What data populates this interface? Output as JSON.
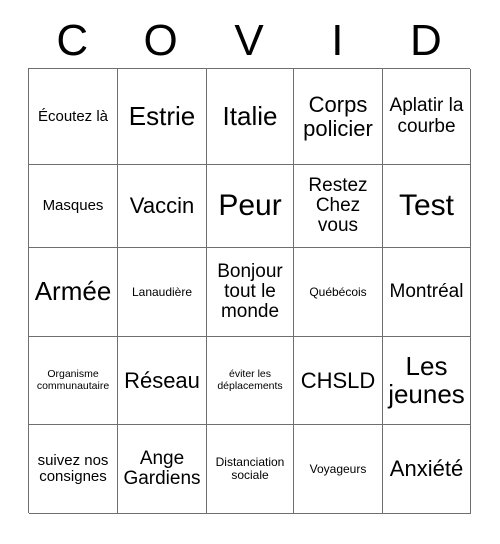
{
  "card": {
    "header_letters": [
      "C",
      "O",
      "V",
      "I",
      "D"
    ],
    "columns": 5,
    "rows": 5,
    "border_color": "#6f6f6f",
    "text_color": "#000000",
    "background_color": "#ffffff",
    "cells": [
      [
        {
          "label": "Écoutez là",
          "size": "sm"
        },
        {
          "label": "Estrie",
          "size": "xl"
        },
        {
          "label": "Italie",
          "size": "xl"
        },
        {
          "label": "Corps policier",
          "size": "lg"
        },
        {
          "label": "Aplatir la courbe",
          "size": "md"
        }
      ],
      [
        {
          "label": "Masques",
          "size": "sm"
        },
        {
          "label": "Vaccin",
          "size": "lg"
        },
        {
          "label": "Peur",
          "size": "xxl"
        },
        {
          "label": "Restez Chez vous",
          "size": "md"
        },
        {
          "label": "Test",
          "size": "xxl"
        }
      ],
      [
        {
          "label": "Armée",
          "size": "xl"
        },
        {
          "label": "Lanaudière",
          "size": "xs"
        },
        {
          "label": "Bonjour tout le monde",
          "size": "md"
        },
        {
          "label": "Québécois",
          "size": "xs"
        },
        {
          "label": "Montréal",
          "size": "md"
        }
      ],
      [
        {
          "label": "Organisme communautaire",
          "size": "xxs"
        },
        {
          "label": "Réseau",
          "size": "lg"
        },
        {
          "label": "éviter les déplacements",
          "size": "xxs"
        },
        {
          "label": "CHSLD",
          "size": "lg"
        },
        {
          "label": "Les jeunes",
          "size": "xl"
        }
      ],
      [
        {
          "label": "suivez nos consignes",
          "size": "sm"
        },
        {
          "label": "Ange Gardiens",
          "size": "md"
        },
        {
          "label": "Distanciation sociale",
          "size": "xs"
        },
        {
          "label": "Voyageurs",
          "size": "xs"
        },
        {
          "label": "Anxiété",
          "size": "lg"
        }
      ]
    ]
  }
}
